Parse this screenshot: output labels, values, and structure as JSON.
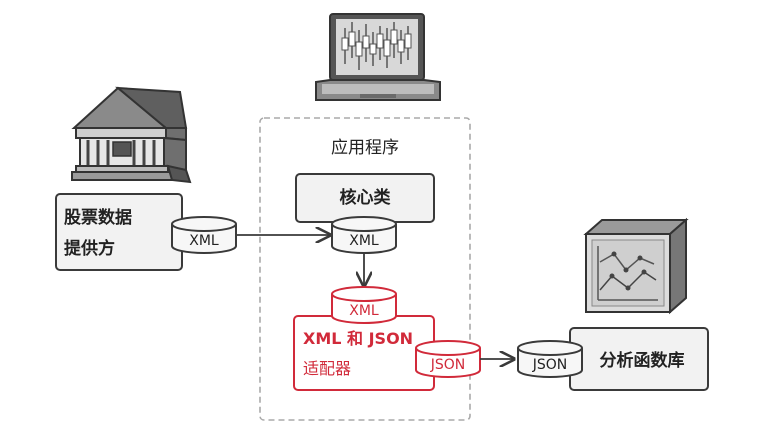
{
  "diagram": {
    "app_group_label": "应用程序",
    "stock_provider_line1": "股票数据",
    "stock_provider_line2": "提供方",
    "core_class_label": "核心类",
    "adapter_line1": "XML 和 JSON",
    "adapter_line2": "适配器",
    "analytics_label": "分析函数库",
    "xml_provider_tag": "XML",
    "xml_core_tag": "XML",
    "xml_adapter_tag": "XML",
    "json_adapter_tag": "JSON",
    "json_analytics_tag": "JSON"
  },
  "colors": {
    "accent_red": "#d12a3a",
    "box_fill": "#f2f2f2",
    "stroke": "#3a3a3a",
    "dashed": "#aaaaaa"
  },
  "icons": {
    "bank": "bank-building-icon",
    "laptop": "laptop-icon",
    "database_cube": "database-cube-icon"
  }
}
